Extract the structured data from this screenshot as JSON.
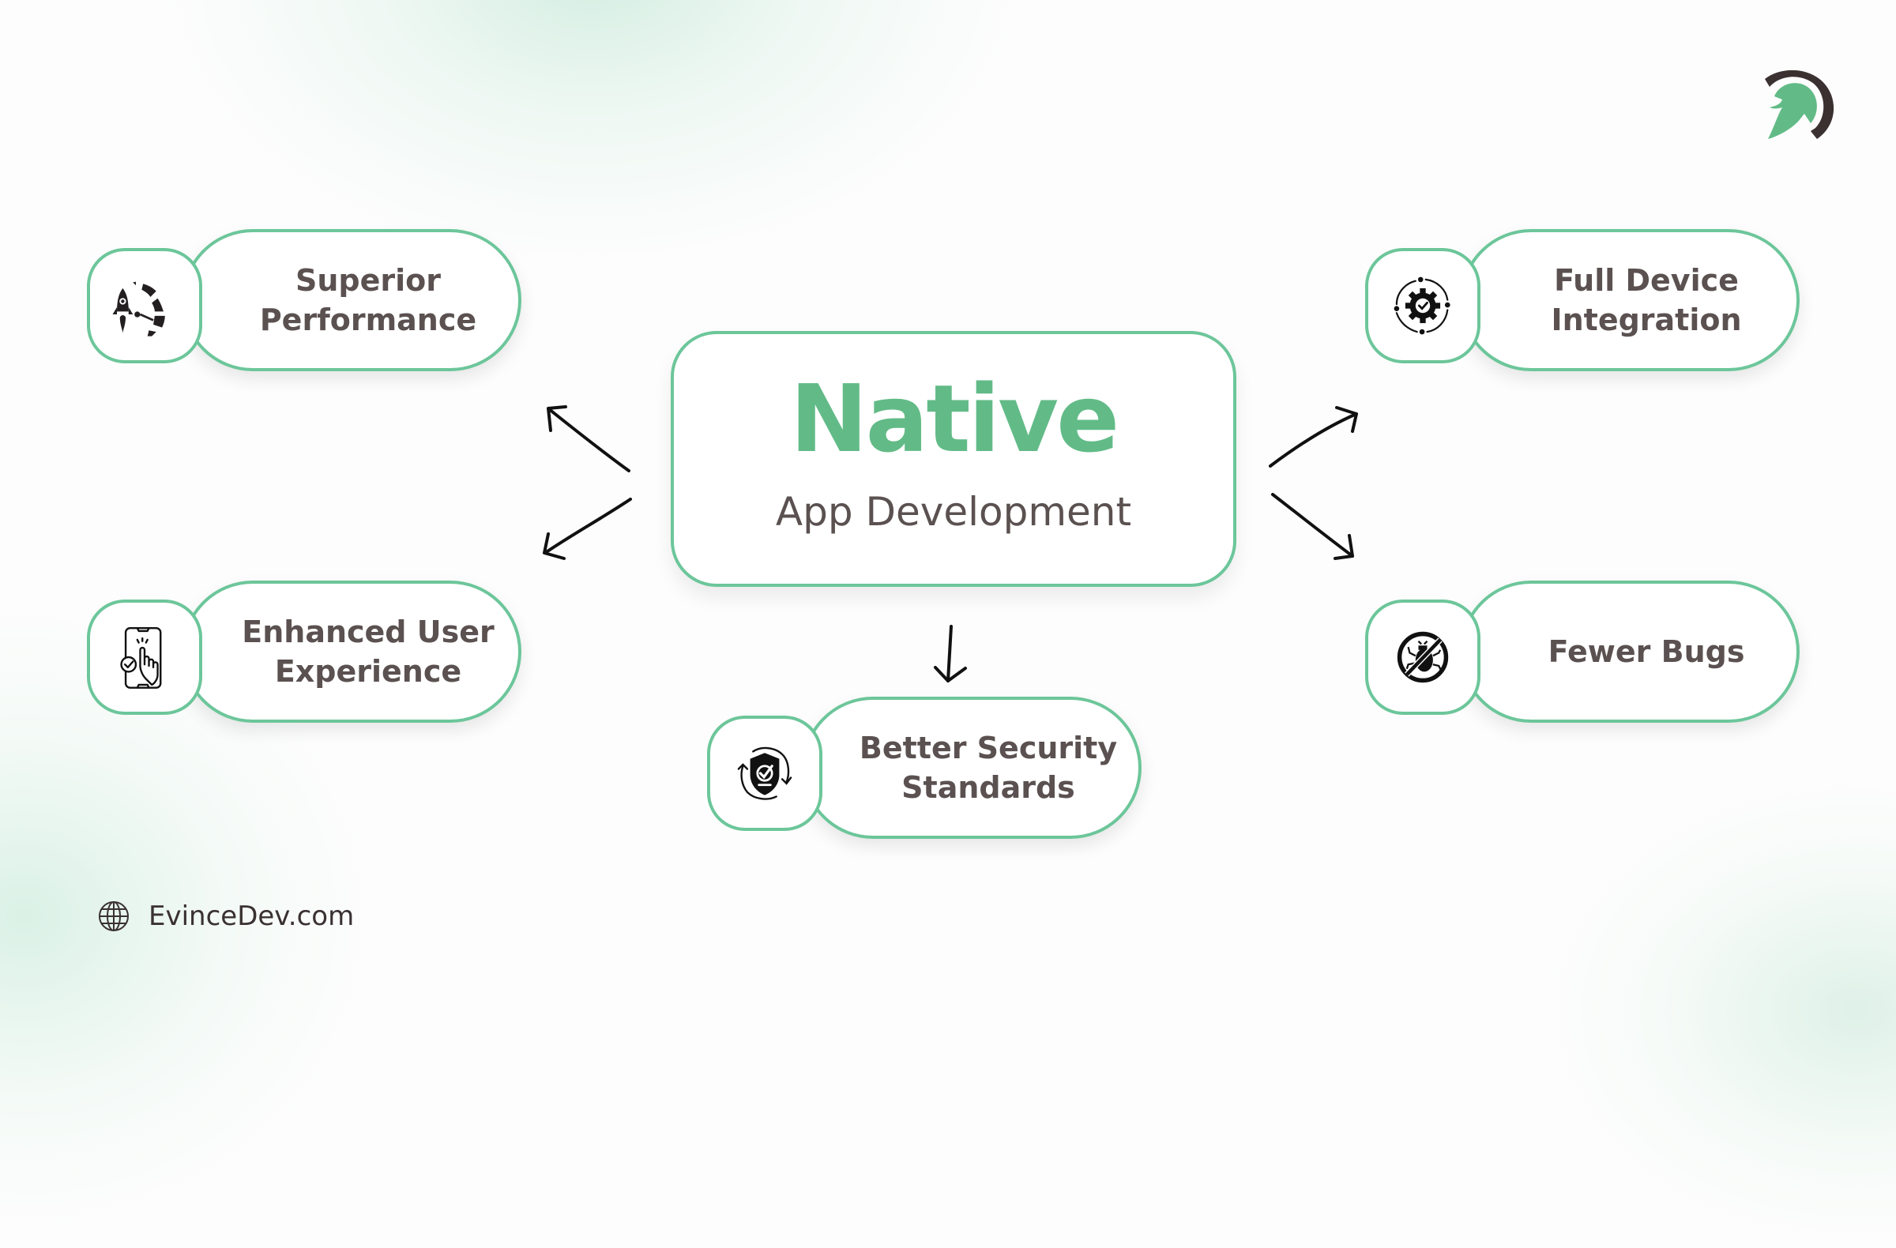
{
  "colors": {
    "accent_green": "#62bb87",
    "border_green": "#6cc69a",
    "text_dark": "#5a5150",
    "logo_dark": "#3b3131"
  },
  "center": {
    "title": "Native",
    "subtitle": "App Development"
  },
  "features": [
    {
      "label_line1": "Superior",
      "label_line2": "Performance",
      "icon": "rocket-speedometer-icon"
    },
    {
      "label_line1": "Enhanced User",
      "label_line2": "Experience",
      "icon": "phone-touch-check-icon"
    },
    {
      "label_line1": "Better Security",
      "label_line2": "Standards",
      "icon": "shield-check-refresh-icon"
    },
    {
      "label_line1": "Full Device",
      "label_line2": "Integration",
      "icon": "gear-check-cycle-icon"
    },
    {
      "label_line1": "Fewer Bugs",
      "label_line2": "",
      "icon": "no-bug-icon"
    }
  ],
  "footer": {
    "icon": "globe-icon",
    "website": "EvinceDev.com"
  },
  "logo": {
    "icon": "spartan-helmet-logo"
  }
}
